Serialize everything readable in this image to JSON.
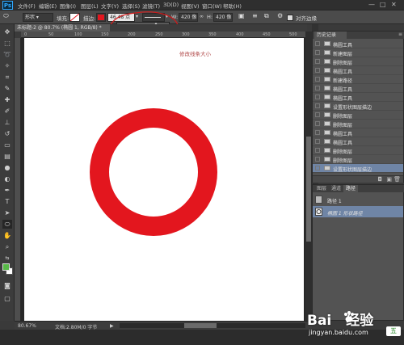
{
  "menubar": {
    "logo": "Ps",
    "items": [
      "文件(F)",
      "编辑(E)",
      "图像(I)",
      "图层(L)",
      "文字(Y)",
      "选择(S)",
      "滤镜(T)",
      "3D(D)",
      "视图(V)",
      "窗口(W)",
      "帮助(H)"
    ],
    "window_controls": [
      "—",
      "□",
      "✕"
    ]
  },
  "options_bar": {
    "shape_mode": "形状",
    "fill_label": "填充:",
    "stroke_label": "描边:",
    "stroke_size": "46.48 点",
    "width_label": "W:",
    "width_value": "420 像",
    "height_label": "H:",
    "height_value": "420 像",
    "align_edges": "对齐边缘",
    "stroke_color": "#e3161e"
  },
  "document": {
    "tab_title": "未标题-2 @ 80.7% (椭圆 1, RGB/8) *",
    "ruler_ticks": [
      "0",
      "50",
      "100",
      "150",
      "200",
      "250",
      "300",
      "350",
      "400",
      "450",
      "500"
    ],
    "annotation": "修改线条大小",
    "ring_color": "#e3161e"
  },
  "statusbar": {
    "zoom": "80.67%",
    "doc_info": "文档:2.80M/0 字节"
  },
  "history": {
    "tab": "历史记录",
    "items": [
      "椭圆工具",
      "新建图层",
      "删除图层",
      "椭圆工具",
      "新建路径",
      "椭圆工具",
      "椭圆工具",
      "设置形状图层描边",
      "删除图层",
      "删除图层",
      "椭圆工具",
      "椭圆工具",
      "删除图层",
      "删除图层",
      "设置形状图层描边"
    ],
    "selected_index": 14
  },
  "paths": {
    "tabs": [
      "图层",
      "通道",
      "路径"
    ],
    "active_tab": 2,
    "items": [
      "路径 1",
      "椭圆 1 形状路径"
    ]
  },
  "watermark": {
    "brand_left": "Bai",
    "brand_right": "经验",
    "url": "jingyan.baidu.com",
    "badge": "五"
  }
}
